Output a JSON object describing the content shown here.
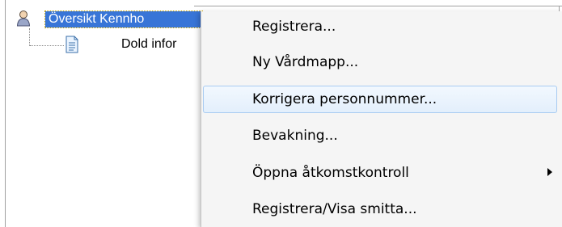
{
  "tree": {
    "root": {
      "label": "Översikt Kennho",
      "icon": "person-icon",
      "selected": true
    },
    "child": {
      "label": "Dold infor",
      "icon": "document-icon"
    }
  },
  "context_menu": {
    "items": [
      {
        "label": "Registrera...",
        "highlighted": false,
        "has_submenu": false
      },
      {
        "label": "Ny Vårdmapp...",
        "highlighted": false,
        "has_submenu": false
      },
      {
        "label": "Korrigera personnummer...",
        "highlighted": true,
        "has_submenu": false
      },
      {
        "label": "Bevakning...",
        "highlighted": false,
        "has_submenu": false
      },
      {
        "label": "Öppna åtkomstkontroll",
        "highlighted": false,
        "has_submenu": true
      },
      {
        "label": "Registrera/Visa smitta...",
        "highlighted": false,
        "has_submenu": false
      }
    ]
  },
  "colors": {
    "selection": "#3875d7",
    "menu_background": "#f5f5f5",
    "menu_highlight_border": "#a8cbf1"
  }
}
